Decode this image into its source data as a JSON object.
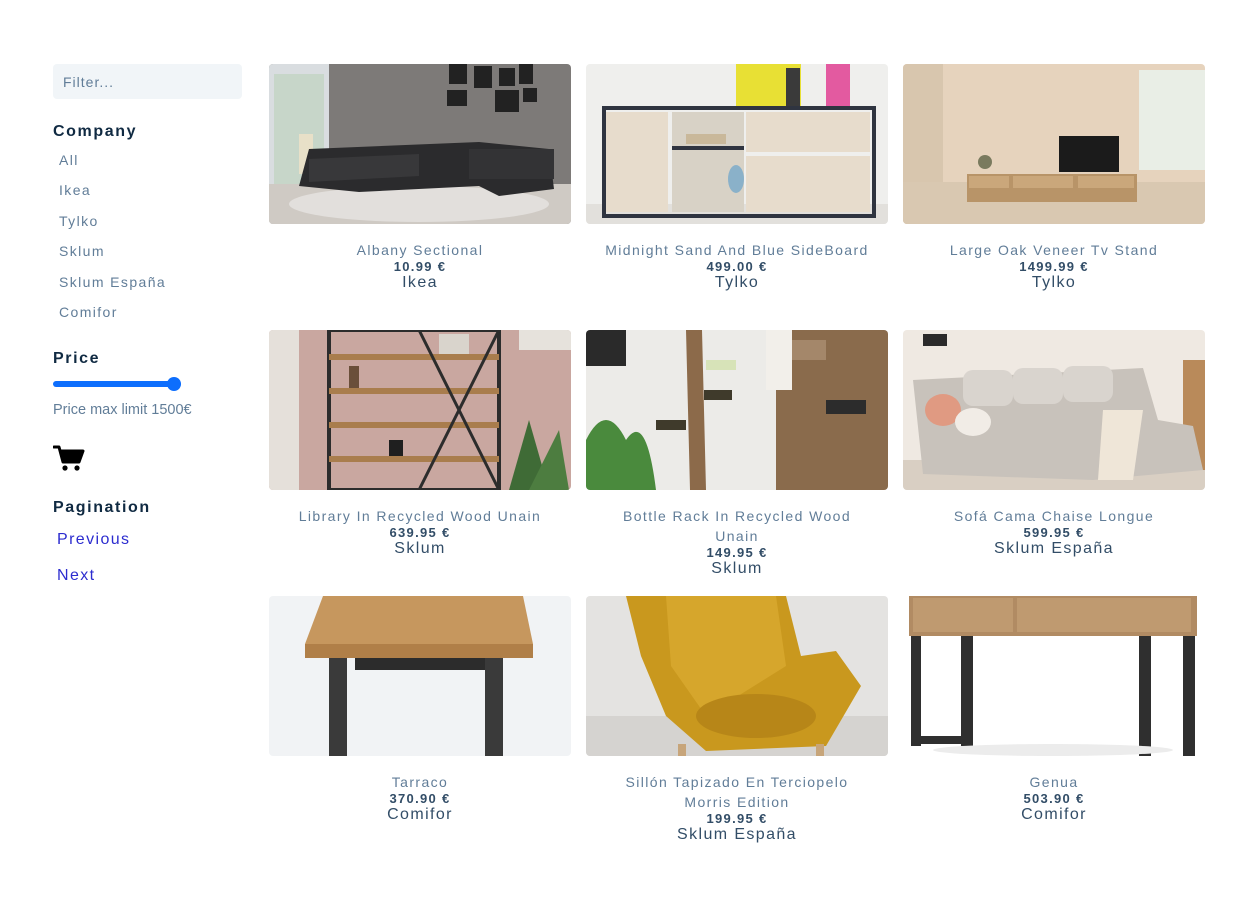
{
  "sidebar": {
    "filter_placeholder": "Filter...",
    "company_title": "Company",
    "companies": [
      "All",
      "Ikea",
      "Tylko",
      "Sklum",
      "Sklum España",
      "Comifor"
    ],
    "price_title": "Price",
    "price_slider_fraction": 1.0,
    "price_limit_text": "Price max limit 1500€",
    "cart_icon": "shopping-cart-icon",
    "pagination_title": "Pagination",
    "previous_label": "Previous",
    "next_label": "Next"
  },
  "colors": {
    "accent": "#0d6efd",
    "link": "#2c2ccf",
    "text_muted": "#617d98",
    "text_dark": "#324d67"
  },
  "products": [
    {
      "name": "Albany Sectional",
      "price": "10.99 €",
      "company": "Ikea",
      "image": "sectional-sofa-photo"
    },
    {
      "name": "Midnight Sand And Blue SideBoard",
      "price": "499.00 €",
      "company": "Tylko",
      "image": "sideboard-photo"
    },
    {
      "name": "Large Oak Veneer Tv Stand",
      "price": "1499.99 €",
      "company": "Tylko",
      "image": "tv-stand-photo"
    },
    {
      "name": "Library In Recycled Wood Unain",
      "price": "639.95 €",
      "company": "Sklum",
      "image": "bookshelf-photo"
    },
    {
      "name": "Bottle Rack In Recycled Wood Unain",
      "price": "149.95 €",
      "company": "Sklum",
      "image": "bottle-rack-photo"
    },
    {
      "name": "Sofá Cama Chaise Longue",
      "price": "599.95 €",
      "company": "Sklum España",
      "image": "sofa-bed-photo"
    },
    {
      "name": "Tarraco",
      "price": "370.90 €",
      "company": "Comifor",
      "image": "wood-table-photo"
    },
    {
      "name": "Sillón Tapizado En Terciopelo Morris Edition",
      "price": "199.95 €",
      "company": "Sklum España",
      "image": "velvet-armchair-photo"
    },
    {
      "name": "Genua",
      "price": "503.90 €",
      "company": "Comifor",
      "image": "console-desk-photo"
    }
  ]
}
